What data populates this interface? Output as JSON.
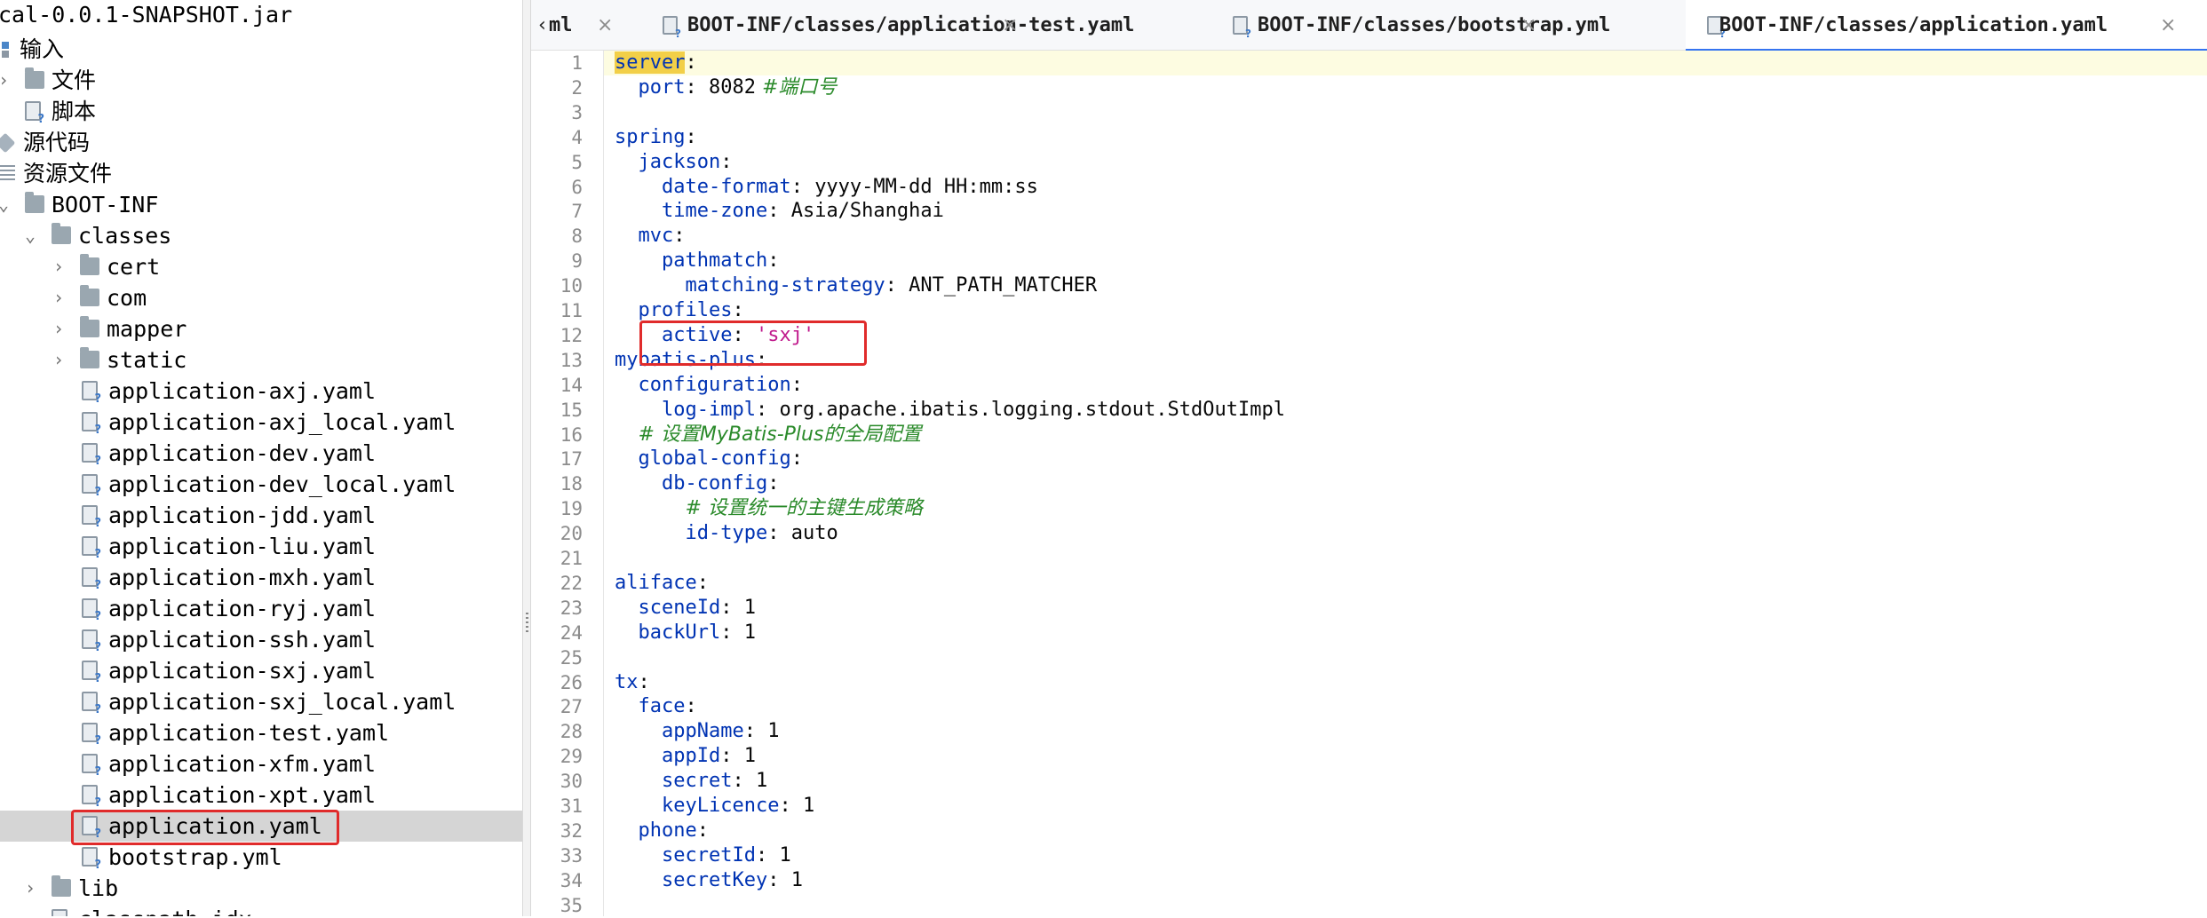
{
  "tree": {
    "rows": [
      {
        "label": "cal-0.0.1-SNAPSHOT.jar",
        "icon": "none"
      },
      {
        "label": "输入",
        "icon": "grid-icon"
      },
      {
        "label": "文件",
        "icon": "folder-icon"
      },
      {
        "label": "脚本",
        "icon": "file-icon"
      },
      {
        "label": "源代码",
        "icon": "package-icon"
      },
      {
        "label": "资源文件",
        "icon": "resource-icon"
      },
      {
        "label": "BOOT-INF",
        "icon": "folder-icon"
      },
      {
        "label": "classes",
        "icon": "folder-icon"
      },
      {
        "label": "cert",
        "icon": "folder-icon"
      },
      {
        "label": "com",
        "icon": "folder-icon"
      },
      {
        "label": "mapper",
        "icon": "folder-icon"
      },
      {
        "label": "static",
        "icon": "folder-icon"
      },
      {
        "label": "application-axj.yaml",
        "icon": "yaml-file-icon"
      },
      {
        "label": "application-axj_local.yaml",
        "icon": "yaml-file-icon"
      },
      {
        "label": "application-dev.yaml",
        "icon": "yaml-file-icon"
      },
      {
        "label": "application-dev_local.yaml",
        "icon": "yaml-file-icon"
      },
      {
        "label": "application-jdd.yaml",
        "icon": "yaml-file-icon"
      },
      {
        "label": "application-liu.yaml",
        "icon": "yaml-file-icon"
      },
      {
        "label": "application-mxh.yaml",
        "icon": "yaml-file-icon"
      },
      {
        "label": "application-ryj.yaml",
        "icon": "yaml-file-icon"
      },
      {
        "label": "application-ssh.yaml",
        "icon": "yaml-file-icon"
      },
      {
        "label": "application-sxj.yaml",
        "icon": "yaml-file-icon"
      },
      {
        "label": "application-sxj_local.yaml",
        "icon": "yaml-file-icon"
      },
      {
        "label": "application-test.yaml",
        "icon": "yaml-file-icon"
      },
      {
        "label": "application-xfm.yaml",
        "icon": "yaml-file-icon"
      },
      {
        "label": "application-xpt.yaml",
        "icon": "yaml-file-icon"
      },
      {
        "label": "application.yaml",
        "icon": "yaml-file-icon"
      },
      {
        "label": "bootstrap.yml",
        "icon": "yaml-file-icon"
      },
      {
        "label": "lib",
        "icon": "folder-icon"
      },
      {
        "label": "classpath.idx",
        "icon": "file-icon"
      }
    ]
  },
  "tabs": [
    {
      "label": "ml",
      "close": "×"
    },
    {
      "label": "BOOT-INF/classes/application-test.yaml",
      "close": "×"
    },
    {
      "label": "BOOT-INF/classes/bootstrap.yml",
      "close": "×"
    },
    {
      "label": "BOOT-INF/classes/application.yaml",
      "close": "×"
    }
  ],
  "tab_prefix": "‹",
  "editor": {
    "line_numbers": [
      "1",
      "2",
      "3",
      "4",
      "5",
      "6",
      "7",
      "8",
      "9",
      "10",
      "11",
      "12",
      "13",
      "14",
      "15",
      "16",
      "17",
      "18",
      "19",
      "20",
      "21",
      "22",
      "23",
      "24",
      "25",
      "26",
      "27",
      "28",
      "29",
      "30",
      "31",
      "32",
      "33",
      "34",
      "35"
    ],
    "lines": [
      {
        "key": "server",
        "sep": ":"
      },
      {
        "key": "port",
        "sep": ": ",
        "value": "8082",
        "comment": "#端口号"
      },
      {},
      {
        "key": "spring",
        "sep": ":"
      },
      {
        "key": "jackson",
        "sep": ":"
      },
      {
        "key": "date-format",
        "sep": ": ",
        "value": "yyyy-MM-dd HH:mm:ss"
      },
      {
        "key": "time-zone",
        "sep": ": ",
        "value": "Asia/Shanghai"
      },
      {
        "key": "mvc",
        "sep": ":"
      },
      {
        "key": "pathmatch",
        "sep": ":"
      },
      {
        "key": "matching-strategy",
        "sep": ": ",
        "value": "ANT_PATH_MATCHER"
      },
      {
        "key": "profiles",
        "sep": ":"
      },
      {
        "key": "active",
        "sep": ": ",
        "value": "'sxj'"
      },
      {
        "key": "mybatis-plus",
        "sep": ":"
      },
      {
        "key": "configuration",
        "sep": ":"
      },
      {
        "key": "log-impl",
        "sep": ": ",
        "value": "org.apache.ibatis.logging.stdout.StdOutImpl"
      },
      {
        "comment": "# 设置MyBatis-Plus的全局配置"
      },
      {
        "key": "global-config",
        "sep": ":"
      },
      {
        "key": "db-config",
        "sep": ":"
      },
      {
        "comment": "# 设置统一的主键生成策略"
      },
      {
        "key": "id-type",
        "sep": ": ",
        "value": "auto"
      },
      {},
      {
        "key": "aliface",
        "sep": ":"
      },
      {
        "key": "sceneId",
        "sep": ": ",
        "value": "1"
      },
      {
        "key": "backUrl",
        "sep": ": ",
        "value": "1"
      },
      {},
      {
        "key": "tx",
        "sep": ":"
      },
      {
        "key": "face",
        "sep": ":"
      },
      {
        "key": "appName",
        "sep": ": ",
        "value": "1"
      },
      {
        "key": "appId",
        "sep": ": ",
        "value": "1"
      },
      {
        "key": "secret",
        "sep": ": ",
        "value": "1"
      },
      {
        "key": "keyLicence",
        "sep": ": ",
        "value": "1"
      },
      {
        "key": "phone",
        "sep": ":"
      },
      {
        "key": "secretId",
        "sep": ": ",
        "value": "1"
      },
      {
        "key": "secretKey",
        "sep": ": ",
        "value": "1"
      },
      {}
    ]
  },
  "colors": {
    "highlight_box": "#e02b2b",
    "selected_row": "#d5d5d5",
    "key": "#0033b3",
    "string": "#c01a8c",
    "comment": "#2a8a2a",
    "active_tab_underline": "#3574f0"
  }
}
